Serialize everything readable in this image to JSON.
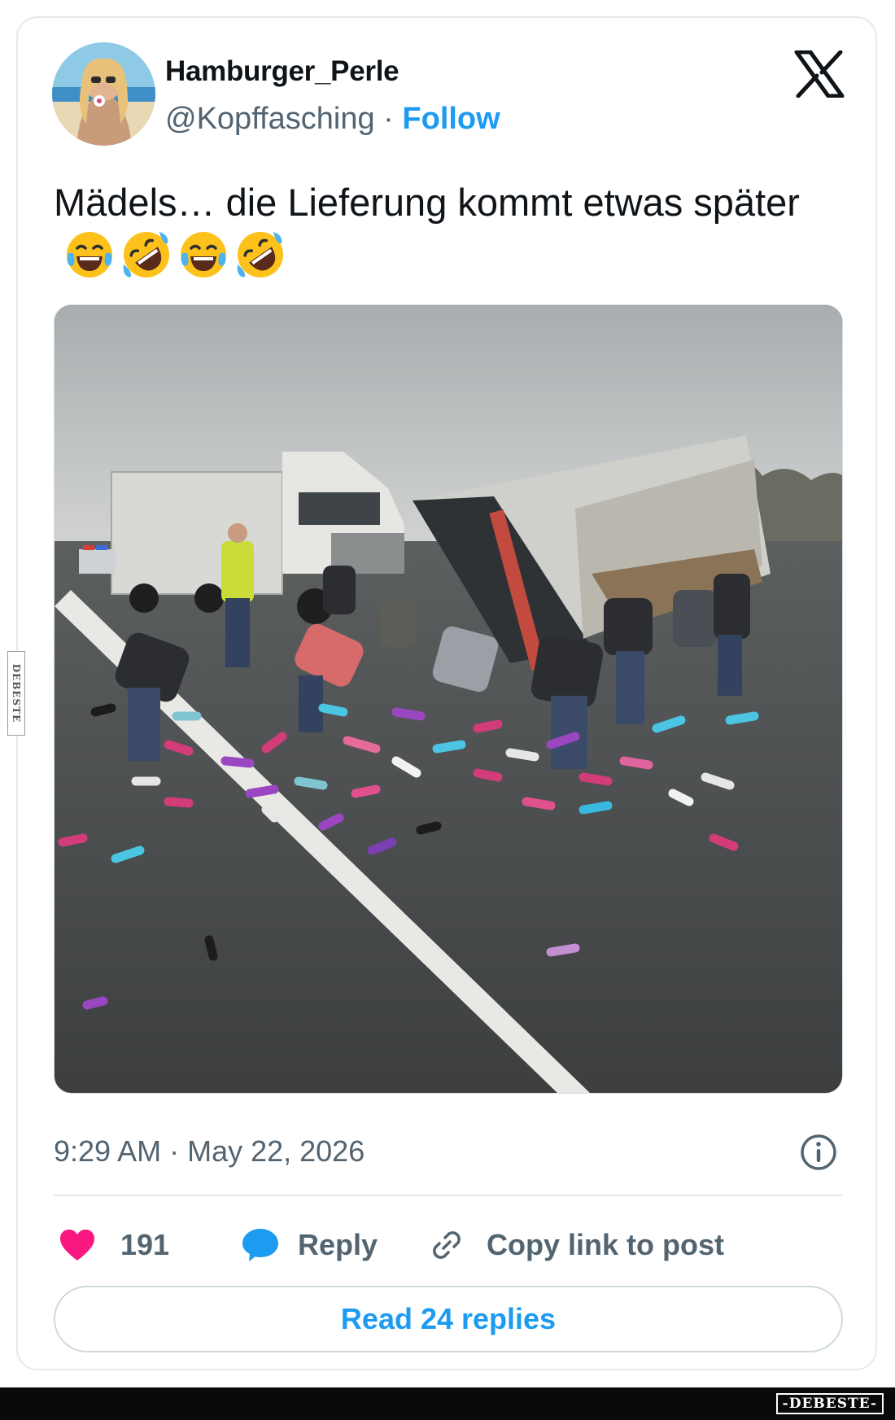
{
  "tweet": {
    "author": {
      "display_name": "Hamburger_Perle",
      "handle": "@Kopffasching",
      "separator": " · ",
      "follow_label": "Follow",
      "avatar_icon": "user-avatar-photo"
    },
    "platform_icon": "x-logo-icon",
    "text": "Mädels… die Lieferung kommt etwas später",
    "emojis": [
      "face-with-tears-of-joy",
      "rolling-on-the-floor-laughing",
      "face-with-tears-of-joy",
      "rolling-on-the-floor-laughing"
    ],
    "media": {
      "kind": "photo"
    },
    "timestamp": "9:29 AM · May 22, 2026",
    "info_icon": "info-icon",
    "actions": {
      "like_count": "191",
      "reply_label": "Reply",
      "copy_link_label": "Copy link to post"
    },
    "read_replies_label": "Read 24 replies"
  },
  "watermarks": {
    "side": "DEBESTE",
    "bottom": "-DEBESTE-"
  },
  "colors": {
    "accent": "#1d9bf0",
    "like": "#f91880",
    "text_secondary": "#536471",
    "text_primary": "#0f1419",
    "border": "#e6e9ec"
  }
}
